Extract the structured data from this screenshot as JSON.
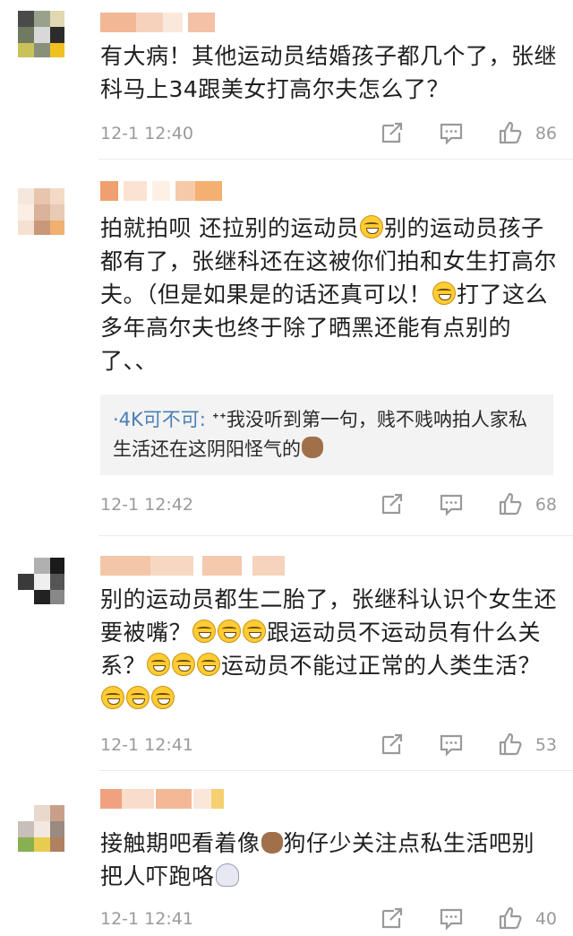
{
  "comments": [
    {
      "text_parts": [
        "有大病！其他运动员结婚孩子都几个了，张继科马上34跟美女打高尔夫怎么了？"
      ],
      "time": "12-1 12:40",
      "likes": "86"
    },
    {
      "text_parts": [
        "拍就拍呗 还拉别的运动员",
        "别的运动员孩子都有了，张继科还在这被你们拍和女生打高尔夫。（但是如果是的话还真可以！",
        "打了这么多年高尔夫也终于除了晒黑还能有点别的了、、"
      ],
      "reply": {
        "user": "·4K可不可:",
        "text_parts": [
          " ᕀᕀ我没听到第一句，贱不贱呐拍人家私生活还在这阴阳怪气的"
        ]
      },
      "time": "12-1 12:42",
      "likes": "68"
    },
    {
      "text_parts": [
        "别的运动员都生二胎了，张继科认识个女生还要被嘴？",
        "跟运动员不运动员有什么关系？",
        "运动员不能过正常的人类生活？"
      ],
      "time": "12-1 12:41",
      "likes": "53"
    },
    {
      "text_parts": [
        "接触期吧看着像",
        "狗仔少关注点私生活吧别把人吓跑咯"
      ],
      "time": "12-1 12:41",
      "likes": "40"
    }
  ],
  "icons": {
    "share": "share-icon",
    "comment": "comment-icon",
    "like": "thumbs-up-icon"
  },
  "colors": {
    "reply_user": "#4a7fb5",
    "meta_gray": "#9a9a9a",
    "reply_bg": "#f3f3f3"
  }
}
